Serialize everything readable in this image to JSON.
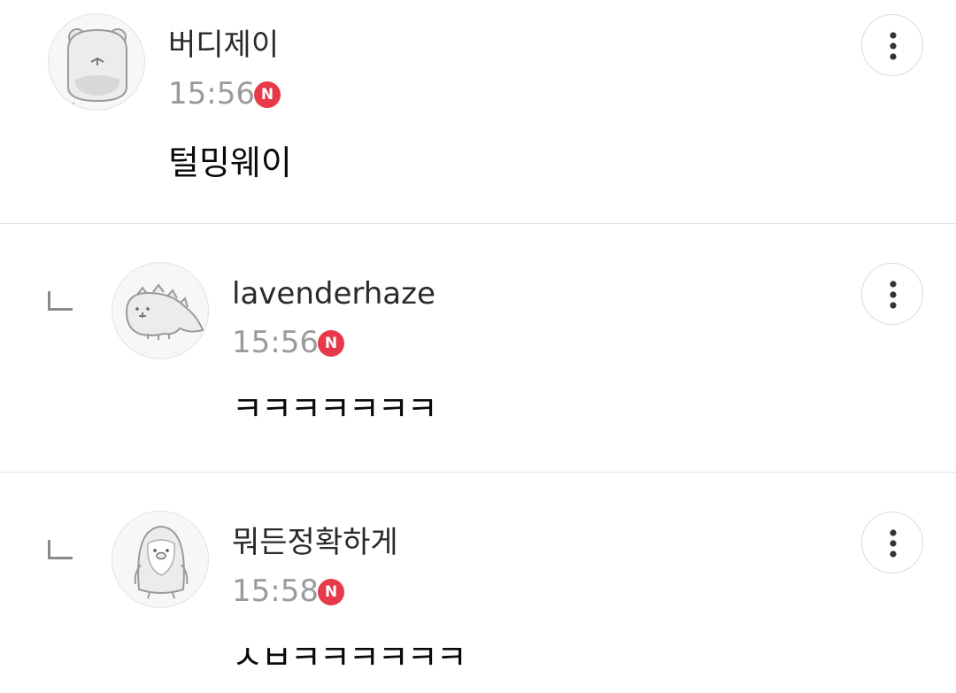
{
  "comments": [
    {
      "author": "버디제이",
      "time": "15:56",
      "badge": "N",
      "text": "털밍웨이",
      "avatar_icon": "hamster-avatar-icon",
      "reply": false
    },
    {
      "author": "lavenderhaze",
      "time": "15:56",
      "badge": "N",
      "text": "ㅋㅋㅋㅋㅋㅋㅋ",
      "avatar_icon": "dinosaur-avatar-icon",
      "reply": true
    },
    {
      "author": "뭐든정확하게",
      "time": "15:58",
      "badge": "N",
      "text": "ㅅㅂㅋㅋㅋㅋㅋㅋ",
      "avatar_icon": "penguin-avatar-icon",
      "reply": true
    }
  ],
  "colors": {
    "badge": "#e8394a",
    "time": "#9a9a9a",
    "divider": "#e3e3e3"
  }
}
